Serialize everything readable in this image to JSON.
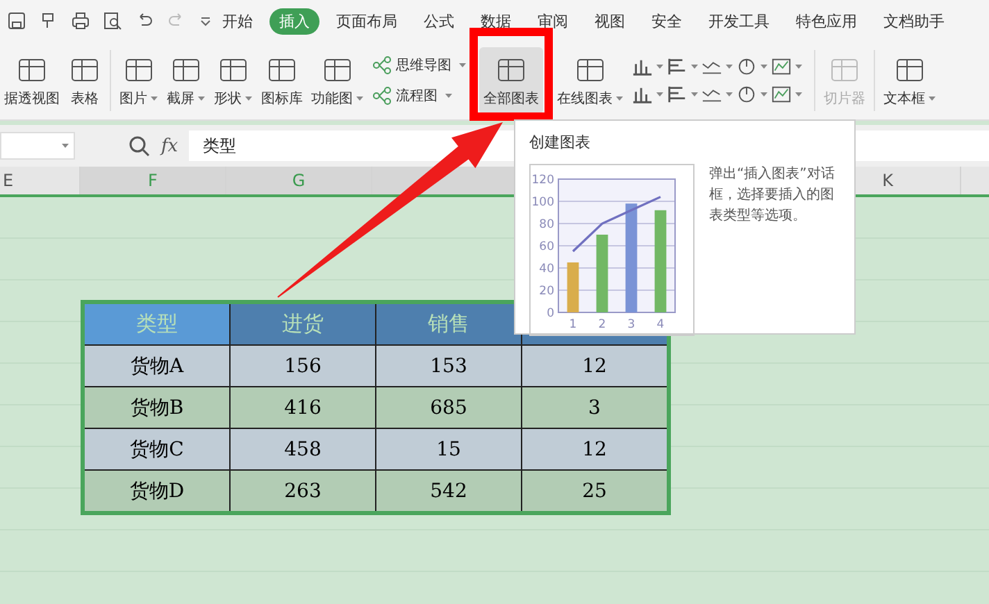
{
  "menu_tabs": [
    {
      "label": "开始",
      "selected": false
    },
    {
      "label": "插入",
      "selected": true
    },
    {
      "label": "页面布局",
      "selected": false
    },
    {
      "label": "公式",
      "selected": false
    },
    {
      "label": "数据",
      "selected": false
    },
    {
      "label": "审阅",
      "selected": false
    },
    {
      "label": "视图",
      "selected": false
    },
    {
      "label": "安全",
      "selected": false
    },
    {
      "label": "开发工具",
      "selected": false
    },
    {
      "label": "特色应用",
      "selected": false
    },
    {
      "label": "文档助手",
      "selected": false
    }
  ],
  "ribbon": [
    {
      "kind": "large",
      "label": "据透视图",
      "dropdown": false,
      "hovered": false,
      "disabled": false
    },
    {
      "kind": "large",
      "label": "表格",
      "dropdown": false,
      "hovered": false,
      "disabled": false
    },
    {
      "kind": "separator"
    },
    {
      "kind": "large",
      "label": "图片",
      "dropdown": true,
      "hovered": false,
      "disabled": false
    },
    {
      "kind": "large",
      "label": "截屏",
      "dropdown": true,
      "hovered": false,
      "disabled": false
    },
    {
      "kind": "large",
      "label": "形状",
      "dropdown": true,
      "hovered": false,
      "disabled": false
    },
    {
      "kind": "large",
      "label": "图标库",
      "dropdown": false,
      "hovered": false,
      "disabled": false
    },
    {
      "kind": "large",
      "label": "功能图",
      "dropdown": true,
      "hovered": false,
      "disabled": false
    },
    {
      "kind": "stack",
      "items": [
        {
          "label": "思维导图",
          "dropdown": true
        },
        {
          "label": "流程图",
          "dropdown": true
        }
      ]
    },
    {
      "kind": "large",
      "label": "全部图表",
      "dropdown": false,
      "hovered": true,
      "disabled": false
    },
    {
      "kind": "large",
      "label": "在线图表",
      "dropdown": true,
      "hovered": false,
      "disabled": false
    },
    {
      "kind": "chart_grid"
    },
    {
      "kind": "separator"
    },
    {
      "kind": "large",
      "label": "切片器",
      "dropdown": false,
      "hovered": false,
      "disabled": true
    },
    {
      "kind": "separator"
    },
    {
      "kind": "large",
      "label": "文本框",
      "dropdown": true,
      "hovered": false,
      "disabled": false
    }
  ],
  "formula_bar": {
    "fx": "fx",
    "value": "类型"
  },
  "columns": [
    {
      "label": "E",
      "selected": false
    },
    {
      "label": "F",
      "selected": true
    },
    {
      "label": "G",
      "selected": true
    },
    {
      "label": "K",
      "selected": false
    }
  ],
  "table": {
    "headers": [
      {
        "text": "类型",
        "active": true
      },
      {
        "text": "进货",
        "active": false
      },
      {
        "text": "销售",
        "active": false
      }
    ],
    "rows": [
      [
        "货物A",
        "156",
        "153",
        "12"
      ],
      [
        "货物B",
        "416",
        "685",
        "3"
      ],
      [
        "货物C",
        "458",
        "15",
        "12"
      ],
      [
        "货物D",
        "263",
        "542",
        "25"
      ]
    ]
  },
  "tooltip": {
    "title": "创建图表",
    "description": "弹出“插入图表”对话框，选择要插入的图表类型等选项。",
    "chart_data": {
      "type": "bar",
      "categories": [
        "1",
        "2",
        "3",
        "4"
      ],
      "stacked": false,
      "series": [
        {
          "type": "bar",
          "color": "#d9ad4c",
          "values": [
            45,
            null,
            null,
            null
          ]
        },
        {
          "type": "bar",
          "color": "#72b865",
          "values": [
            null,
            70,
            null,
            92
          ]
        },
        {
          "type": "bar",
          "color": "#7a93d6",
          "values": [
            null,
            null,
            98,
            null
          ]
        },
        {
          "type": "line",
          "color": "#7070c0",
          "values": [
            55,
            80,
            92,
            104
          ]
        }
      ],
      "ylim": [
        0,
        120
      ],
      "yticks": [
        0,
        20,
        40,
        60,
        80,
        100,
        120
      ],
      "grid": true
    }
  }
}
